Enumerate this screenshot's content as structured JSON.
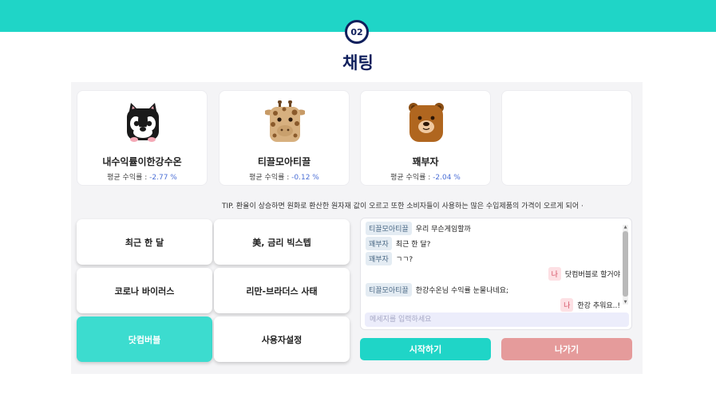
{
  "header": {
    "step": "02",
    "title": "채팅"
  },
  "players": [
    {
      "name": "내수익률이한강수온",
      "return_label": "평균 수익률 :",
      "return_value": "-2.77 %",
      "avatar": "raccoon-icon"
    },
    {
      "name": "티끌모아티끌",
      "return_label": "평균 수익률 :",
      "return_value": "-0.12 %",
      "avatar": "giraffe-icon"
    },
    {
      "name": "꽤부자",
      "return_label": "평균 수익률 :",
      "return_value": "-2.04 %",
      "avatar": "bear-icon"
    }
  ],
  "tip": "TIP. 환율이 상승하면 원화로 환산한 원자재 값이 오르고 또한 소비자들이 사용하는 많은 수입제품의 가격이 오르게 되어 ·",
  "scenarios": [
    "최근 한 달",
    "美, 금리 빅스텝",
    "코로나 바이러스",
    "리만-브라더스 사태",
    "닷컴버블",
    "사용자설정"
  ],
  "chat": {
    "messages": [
      {
        "sender": "티끌모아티끌",
        "text": "우리 무슨게임할까",
        "mine": false
      },
      {
        "sender": "꽤부자",
        "text": "최근 한 달?",
        "mine": false
      },
      {
        "sender": "꽤부자",
        "text": "ㄱㄱ?",
        "mine": false
      },
      {
        "sender": "나",
        "text": "닷컴버블로 할거야",
        "mine": true
      },
      {
        "sender": "티끌모아티끌",
        "text": "한강수온님 수익률 눈물나네요;",
        "mine": false
      },
      {
        "sender": "나",
        "text": "한강 추워요..!",
        "mine": true
      }
    ],
    "input_placeholder": "메세지를 입력하세요"
  },
  "actions": {
    "start": "시작하기",
    "exit": "나가기"
  },
  "colors": {
    "accent": "#1fd5c7",
    "active_scenario": "#3cdccf",
    "exit": "#e59b9b",
    "title": "#0f1f5c"
  }
}
